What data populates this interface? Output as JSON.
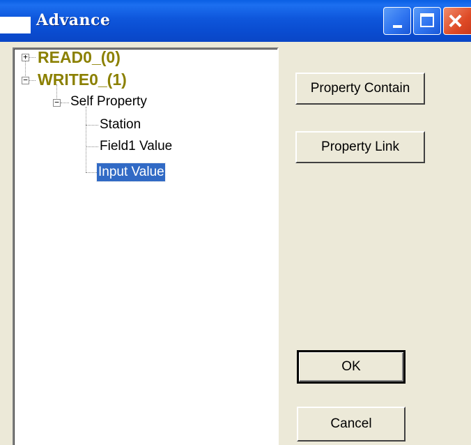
{
  "window": {
    "title": "Advance",
    "controls": [
      "minimize-icon",
      "maximize-icon",
      "close-icon"
    ]
  },
  "tree": {
    "nodes": [
      {
        "label": "READ0_(0)",
        "expander": "+",
        "expanded": false
      },
      {
        "label": "WRITE0_(1)",
        "expander": "−",
        "expanded": true,
        "children": [
          {
            "label": "Self Property",
            "expander": "−",
            "expanded": true,
            "children": [
              {
                "label": "Station"
              },
              {
                "label": "Field1 Value"
              },
              {
                "label": "Input Value",
                "selected": true
              }
            ]
          }
        ]
      }
    ]
  },
  "buttons": {
    "property_contain": "Property Contain",
    "property_link": "Property Link",
    "ok": "OK",
    "cancel": "Cancel"
  },
  "colors": {
    "title_bar": "#0A4CD0",
    "face": "#ECE9D8",
    "top_node_text": "#8B8000",
    "selection": "#316AC5",
    "close_button": "#DE4A26"
  }
}
